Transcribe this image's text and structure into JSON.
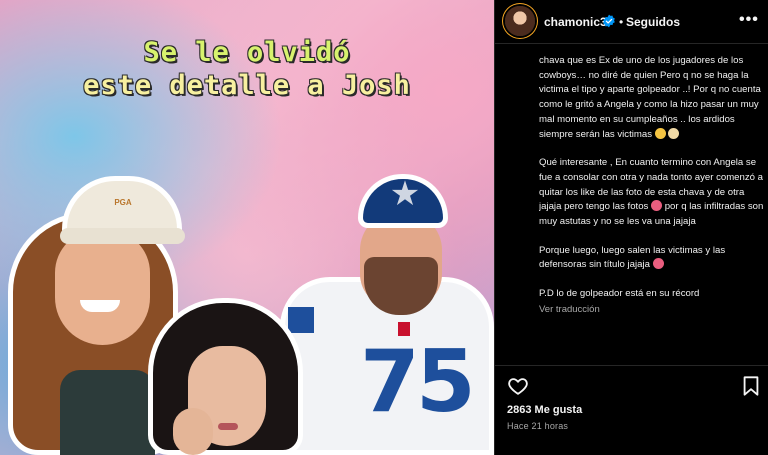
{
  "post": {
    "image": {
      "headline_line1": "Se le olvidó",
      "headline_line2": "este detalle a Josh",
      "cap_logo_text": "PGA",
      "jersey_number": "75"
    },
    "header": {
      "username": "chamonic3",
      "separator": "•",
      "follow_status": "Seguidos",
      "more_icon": "more-options-icon",
      "verified_icon": "verified-badge-icon"
    },
    "caption": {
      "p1": "chava que es Ex de uno de los jugadores de los cowboys… no diré de quien Pero q no se haga la victima el tipo y aparte golpeador ..! Por q no cuenta como le gritó a Angela y como la hizo pasar un muy mal momento en su cumpleaños .. los ardidos siempre serán las victimas",
      "p2a": "Qué interesante , En cuanto termino con Angela se fue a consolar con otra y nada tonto ayer comenzó a quitar los like de las foto de esta chava y de otra jajaja pero tengo las fotos",
      "p2b": "por q las infiltradas son muy astutas y no se les va una jajaja",
      "p3": "Porque luego, luego salen las victimas y las defensoras sin título jajaja",
      "p4": "P.D lo de golpeador está en su récord",
      "see_translation": "Ver traducción"
    },
    "actions": {
      "like_icon": "heart-icon",
      "save_icon": "bookmark-icon"
    },
    "likes": "2863 Me gusta",
    "time_ago": "Hace 21 horas"
  },
  "colors": {
    "background": "#000000",
    "text": "#f5f5f5",
    "muted": "#a8a8a8",
    "verified": "#0095f6",
    "divider": "#262626"
  }
}
